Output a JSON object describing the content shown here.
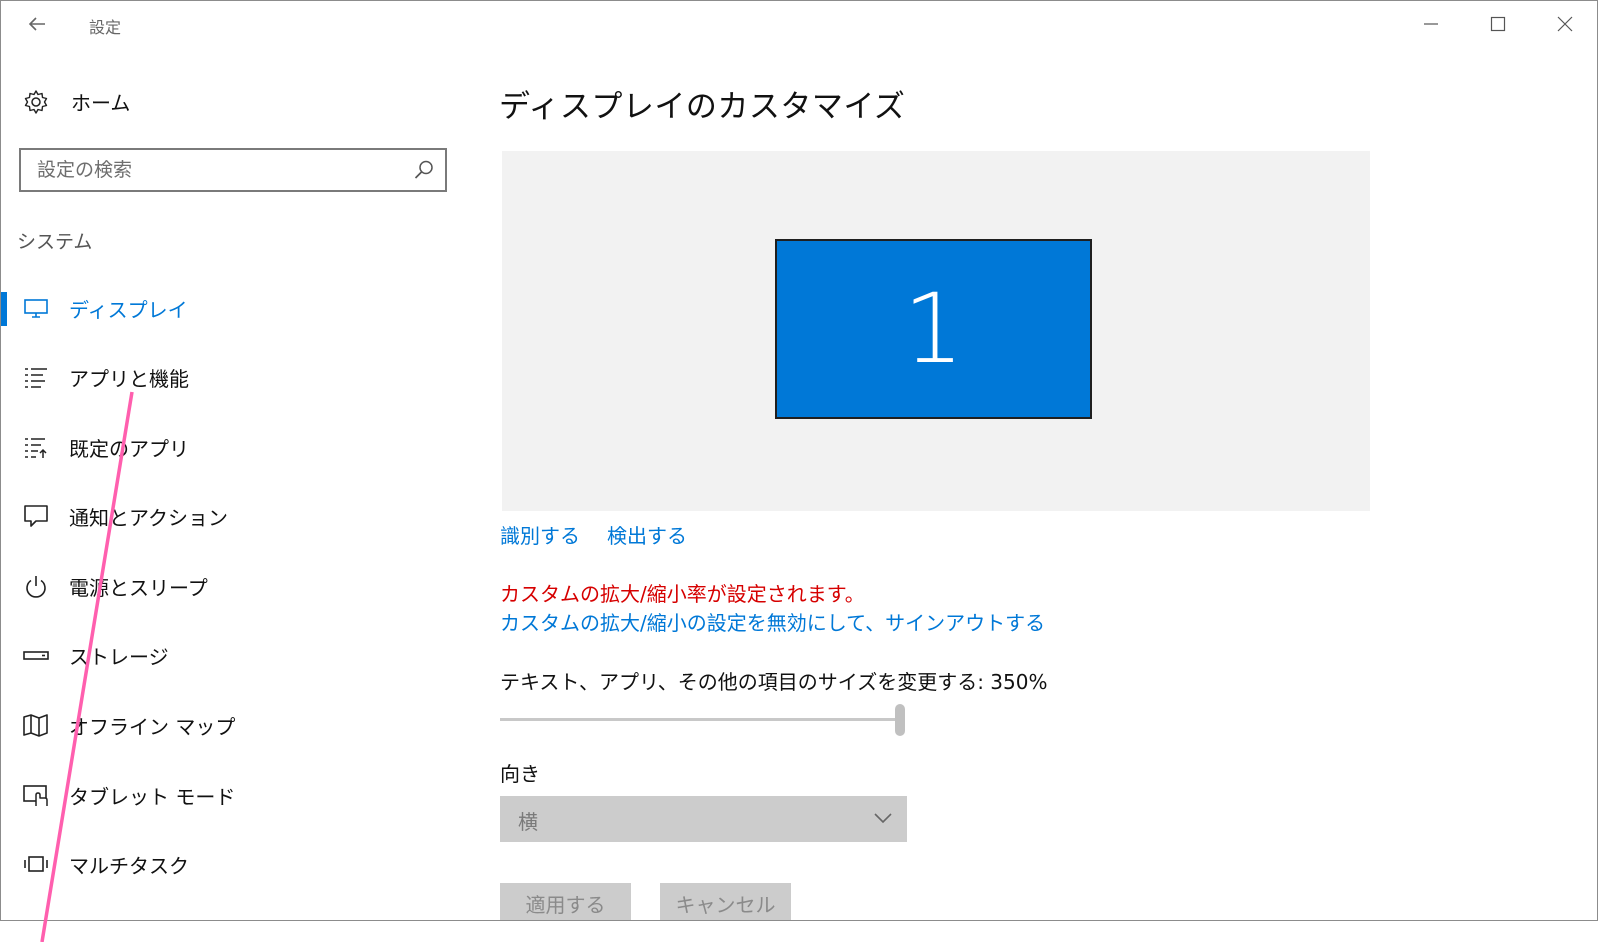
{
  "window": {
    "title": "設定"
  },
  "sidebar": {
    "home_label": "ホーム",
    "search_placeholder": "設定の検索",
    "section_label": "システム",
    "items": [
      {
        "label": "ディスプレイ",
        "icon": "monitor-icon",
        "active": true
      },
      {
        "label": "アプリと機能",
        "icon": "apps-list-icon"
      },
      {
        "label": "既定のアプリ",
        "icon": "default-apps-icon"
      },
      {
        "label": "通知とアクション",
        "icon": "notification-icon"
      },
      {
        "label": "電源とスリープ",
        "icon": "power-icon"
      },
      {
        "label": "ストレージ",
        "icon": "storage-icon"
      },
      {
        "label": "オフライン マップ",
        "icon": "map-icon"
      },
      {
        "label": "タブレット モード",
        "icon": "tablet-mode-icon"
      },
      {
        "label": "マルチタスク",
        "icon": "multitask-icon"
      }
    ]
  },
  "main": {
    "title": "ディスプレイのカスタマイズ",
    "monitor_number": "1",
    "identify_link": "識別する",
    "detect_link": "検出する",
    "custom_scale_warning": "カスタムの拡大/縮小率が設定されます。",
    "disable_custom_scale_link": "カスタムの拡大/縮小の設定を無効にして、サインアウトする",
    "scale_label": "テキスト、アプリ、その他の項目のサイズを変更する: 350%",
    "scale_slider_level": 1.0,
    "orientation_label": "向き",
    "orientation_value": "横",
    "apply_button": "適用する",
    "cancel_button": "キャンセル"
  },
  "colors": {
    "accent": "#0078d7",
    "warning": "#d60000",
    "annotation_line": "#ff5fae"
  }
}
